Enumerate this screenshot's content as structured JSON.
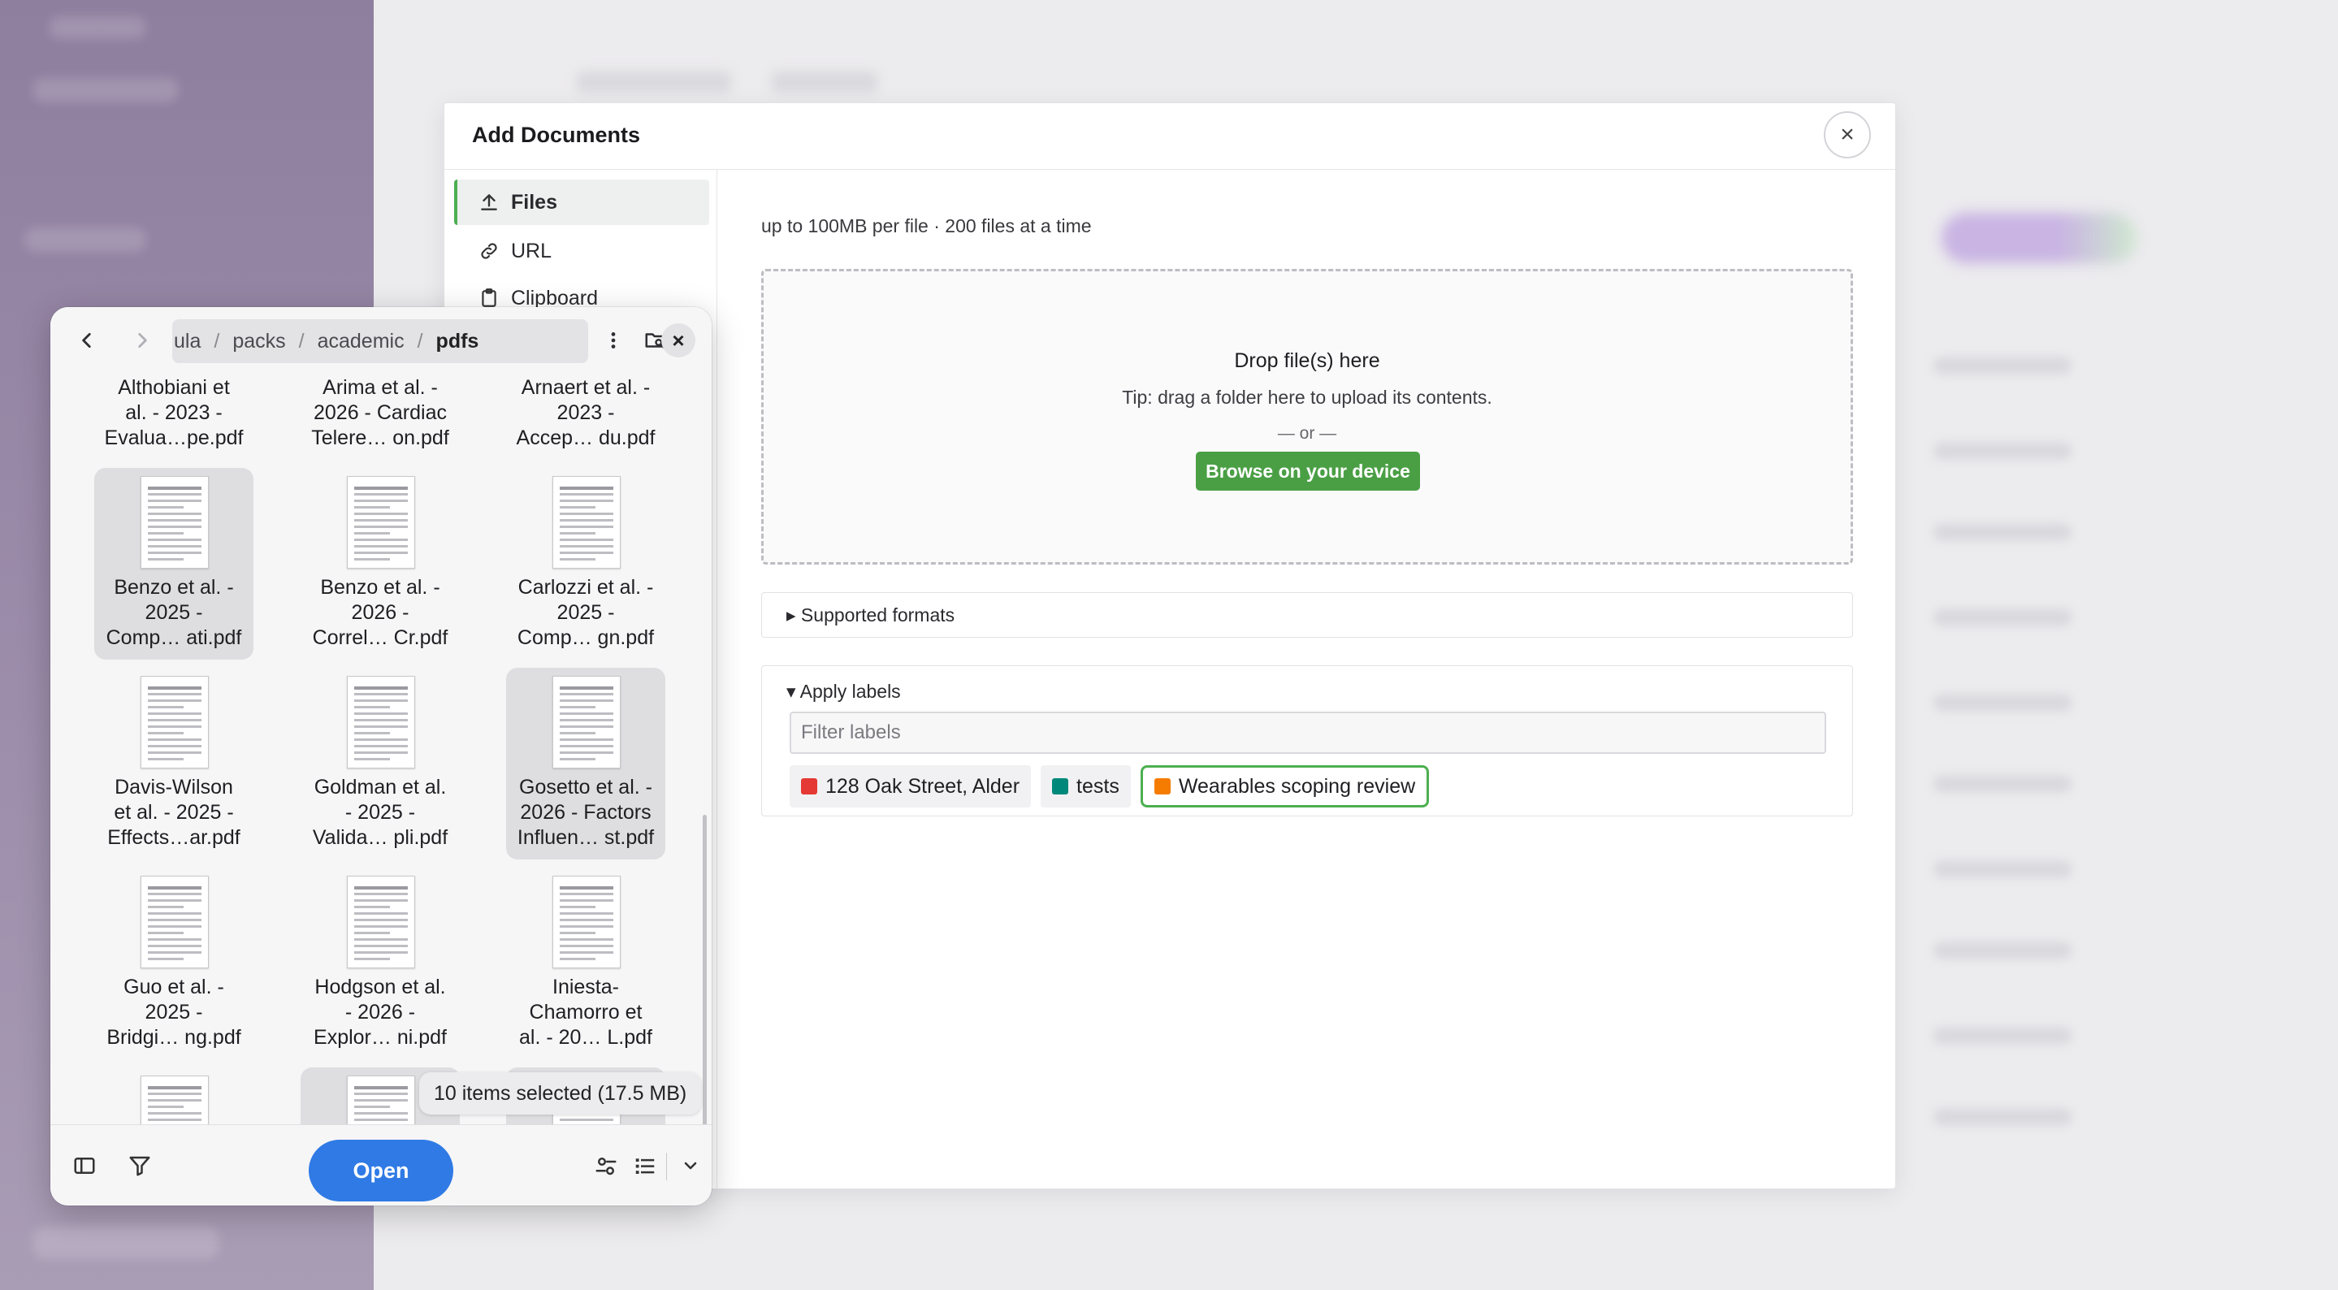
{
  "modal": {
    "title": "Add Documents",
    "close_glyph": "×",
    "nav": [
      {
        "label": "Files",
        "icon": "upload-icon",
        "active": true
      },
      {
        "label": "URL",
        "icon": "link-icon",
        "active": false
      },
      {
        "label": "Clipboard",
        "icon": "clipboard-icon",
        "active": false
      }
    ],
    "limit_text": "up to 100MB per file · 200 files at a time",
    "dropzone": {
      "title": "Drop file(s) here",
      "tip": "Tip: drag a folder here to upload its contents.",
      "or": "— or —",
      "browse_label": "Browse on your device"
    },
    "supported_formats": "▸ Supported formats",
    "labels": {
      "heading": "▾ Apply labels",
      "filter_placeholder": "Filter labels",
      "chips": [
        {
          "label": "128 Oak Street, Alder",
          "color": "#e53935",
          "selected": false
        },
        {
          "label": "tests",
          "color": "#00897b",
          "selected": false
        },
        {
          "label": "Wearables scoping review",
          "color": "#f57c00",
          "selected": true
        }
      ]
    }
  },
  "picker": {
    "breadcrumb": [
      "ula",
      "packs",
      "academic",
      "pdfs"
    ],
    "separator": "/",
    "files": [
      {
        "name": [
          "Althobiani et",
          "al. - 2023 -",
          "Evalua…pe.pdf"
        ],
        "selected": false
      },
      {
        "name": [
          "Arima et al. -",
          "2026 - Cardiac",
          "Telere… on.pdf"
        ],
        "selected": false
      },
      {
        "name": [
          "Arnaert et al. -",
          "2023 -",
          "Accep… du.pdf"
        ],
        "selected": false
      },
      {
        "name": [
          "Benzo et al. -",
          "2025 -",
          "Comp… ati.pdf"
        ],
        "selected": true
      },
      {
        "name": [
          "Benzo et al. -",
          "2026 -",
          "Correl… Cr.pdf"
        ],
        "selected": false
      },
      {
        "name": [
          "Carlozzi et al. -",
          "2025 -",
          "Comp… gn.pdf"
        ],
        "selected": false
      },
      {
        "name": [
          "Davis-Wilson",
          "et al. - 2025 -",
          "Effects…ar.pdf"
        ],
        "selected": false
      },
      {
        "name": [
          "Goldman et al.",
          "- 2025 -",
          "Valida… pli.pdf"
        ],
        "selected": false
      },
      {
        "name": [
          "Gosetto et al. -",
          "2026 - Factors",
          "Influen… st.pdf"
        ],
        "selected": true
      },
      {
        "name": [
          "Guo et al. -",
          "2025 -",
          "Bridgi… ng.pdf"
        ],
        "selected": false
      },
      {
        "name": [
          "Hodgson et al.",
          "- 2026 -",
          "Explor… ni.pdf"
        ],
        "selected": false
      },
      {
        "name": [
          "Iniesta-",
          "Chamorro et",
          "al. - 20… L.pdf"
        ],
        "selected": false
      },
      {
        "name": [],
        "selected": false
      },
      {
        "name": [],
        "selected": true
      },
      {
        "name": [],
        "selected": true
      }
    ],
    "selection_status": "10 items selected  (17.5 MB)",
    "open_label": "Open"
  }
}
